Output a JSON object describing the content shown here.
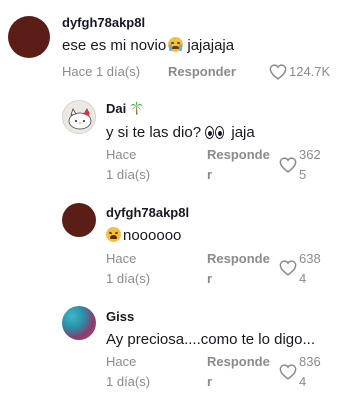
{
  "comments": [
    {
      "username": "dyfgh78akp8l",
      "text_before": "ese es mi novio",
      "emoji": "crying-face",
      "text_after": " jajajaja",
      "time": "Hace 1 día(s)",
      "reply_label": "Responder",
      "likes": "124.7K"
    },
    {
      "username": "Dai",
      "username_flair": "palm-tree",
      "text_before": "y si te las dio? ",
      "emoji": "eyes",
      "text_after": " jaja",
      "time_line1": "Hace",
      "time_line2": "1 día(s)",
      "reply_line1": "Responde",
      "reply_line2": "r",
      "likes_line1": "362",
      "likes_line2": "5"
    },
    {
      "username": "dyfgh78akp8l",
      "emoji": "tired-face",
      "text_after": "noooooo",
      "time_line1": "Hace",
      "time_line2": "1 día(s)",
      "reply_line1": "Responde",
      "reply_line2": "r",
      "likes_line1": "638",
      "likes_line2": "4"
    },
    {
      "username": "Giss",
      "text_before": "Ay preciosa....como te lo digo...",
      "time_line1": "Hace",
      "time_line2": "1 día(s)",
      "reply_line1": "Responde",
      "reply_line2": "r",
      "likes_line1": "836",
      "likes_line2": "4"
    }
  ]
}
